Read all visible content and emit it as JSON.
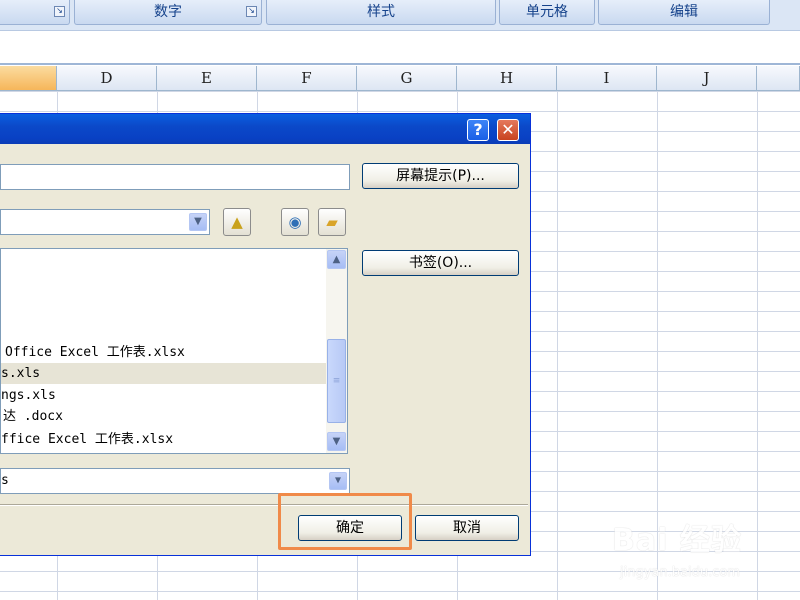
{
  "ribbon": {
    "groups": [
      {
        "label": ""
      },
      {
        "label": "数字"
      },
      {
        "label": "样式"
      },
      {
        "label": "单元格"
      },
      {
        "label": "编辑"
      }
    ],
    "launcher_glyph": "↘"
  },
  "sheet": {
    "columns": [
      "",
      "D",
      "E",
      "F",
      "G",
      "H",
      "I",
      "J"
    ]
  },
  "dialog": {
    "help_glyph": "?",
    "close_glyph": "✕",
    "screentip_button": "屏幕提示(P)...",
    "bookmark_button": "书签(O)...",
    "ok_button": "确定",
    "cancel_button": "取消",
    "address_value": "",
    "lookin_value": "",
    "filetype_value": "s",
    "file_items": [
      {
        "name": "Office Excel 工作表.xlsx"
      },
      {
        "name": "s.xls"
      },
      {
        "name": "ngs.xls"
      },
      {
        "name": "达 .docx"
      },
      {
        "name": "ffice Excel 工作表.xlsx"
      }
    ]
  },
  "watermark": {
    "brand": "Bai 经验",
    "url": "jingyan.baidu.com"
  }
}
